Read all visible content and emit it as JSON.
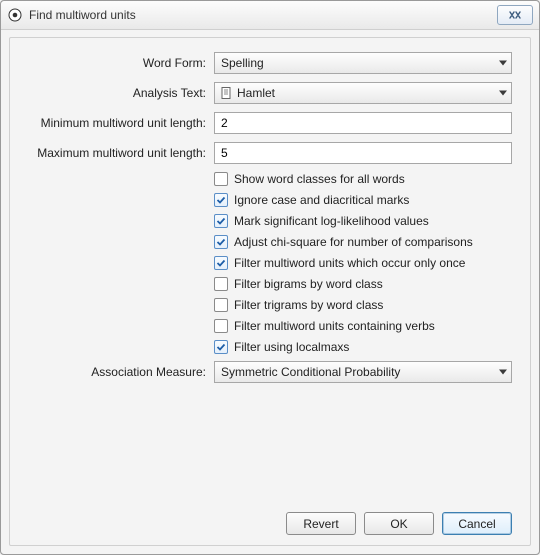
{
  "window": {
    "title": "Find multiword units"
  },
  "labels": {
    "word_form": "Word Form:",
    "analysis_text": "Analysis Text:",
    "min_len": "Minimum multiword unit length:",
    "max_len": "Maximum multiword unit length:",
    "assoc_measure": "Association Measure:"
  },
  "fields": {
    "word_form": {
      "value": "Spelling"
    },
    "analysis_text": {
      "value": "Hamlet"
    },
    "min_len": {
      "value": "2"
    },
    "max_len": {
      "value": "5"
    },
    "assoc_measure": {
      "value": "Symmetric Conditional Probability"
    }
  },
  "checks": [
    {
      "label": "Show word classes for all words",
      "checked": false
    },
    {
      "label": "Ignore case and diacritical marks",
      "checked": true
    },
    {
      "label": "Mark significant log-likelihood values",
      "checked": true
    },
    {
      "label": "Adjust chi-square for number of comparisons",
      "checked": true
    },
    {
      "label": "Filter multiword units which occur only once",
      "checked": true
    },
    {
      "label": "Filter bigrams by word class",
      "checked": false
    },
    {
      "label": "Filter trigrams by word class",
      "checked": false
    },
    {
      "label": "Filter multiword units containing verbs",
      "checked": false
    },
    {
      "label": "Filter using localmaxs",
      "checked": true
    }
  ],
  "buttons": {
    "revert": "Revert",
    "ok": "OK",
    "cancel": "Cancel"
  }
}
